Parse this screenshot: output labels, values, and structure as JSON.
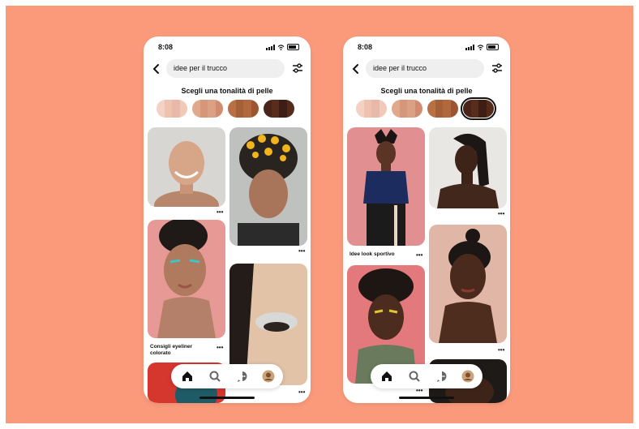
{
  "colors": {
    "background": "#fa9a7b",
    "frame": "#ffffff"
  },
  "phones": [
    {
      "status_time": "8:08",
      "search_value": "idee per il trucco",
      "heading": "Scegli una tonalità di pelle",
      "swatches": [
        [
          "#f3d2c3",
          "#efc2b0",
          "#e8b8a8",
          "#f1c9b9"
        ],
        [
          "#e1a98c",
          "#d6967a",
          "#dca085",
          "#cf8c70"
        ],
        [
          "#b87045",
          "#a66038",
          "#b2683f",
          "#9c5530"
        ],
        [
          "#4a2418",
          "#5a2c1c",
          "#3e1e14",
          "#542a1a"
        ]
      ],
      "selected_swatch": -1,
      "captions": {
        "eyeliner": "Consigli eyeliner colorato"
      },
      "nav_icons": [
        "home-icon",
        "search-icon",
        "chat-icon",
        "profile-avatar"
      ]
    },
    {
      "status_time": "8:08",
      "search_value": "idee per il trucco",
      "heading": "Scegli una tonalità di pelle",
      "swatches": [
        [
          "#f3d2c3",
          "#efc2b0",
          "#e8b8a8",
          "#f1c9b9"
        ],
        [
          "#e1a98c",
          "#d6967a",
          "#dca085",
          "#cf8c70"
        ],
        [
          "#b87045",
          "#a66038",
          "#b2683f",
          "#9c5530"
        ],
        [
          "#4a2418",
          "#5a2c1c",
          "#3e1e14",
          "#542a1a"
        ]
      ],
      "selected_swatch": 3,
      "captions": {
        "sporty": "Idee look sportivo"
      },
      "nav_icons": [
        "home-icon",
        "search-icon",
        "chat-icon",
        "profile-avatar"
      ]
    }
  ],
  "more_label": "•••"
}
